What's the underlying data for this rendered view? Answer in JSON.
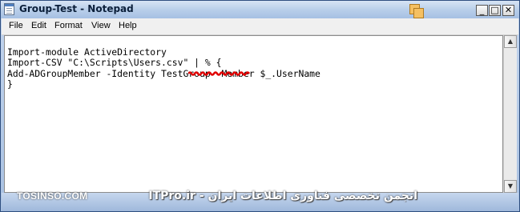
{
  "window": {
    "title": "Group-Test - Notepad"
  },
  "controls": {
    "minimize": "_",
    "maximize": "□",
    "close": "✕"
  },
  "menu": [
    "File",
    "Edit",
    "Format",
    "View",
    "Help"
  ],
  "editor": {
    "lines": [
      "Import-module ActiveDirectory",
      "Import-CSV \"C:\\Scripts\\Users.csv\" | % {",
      "Add-ADGroupMember -Identity TestGroup -Member $_.UserName",
      "}"
    ]
  },
  "scrollbar": {
    "up_arrow": "▲",
    "down_arrow": "▼"
  },
  "watermark": {
    "left": "TOSINSO.COM",
    "right": "انجمن تخصصی فناوری اطلاعات ایران - ITPro.ir"
  },
  "colors": {
    "spell_squiggle": "#e00000"
  }
}
